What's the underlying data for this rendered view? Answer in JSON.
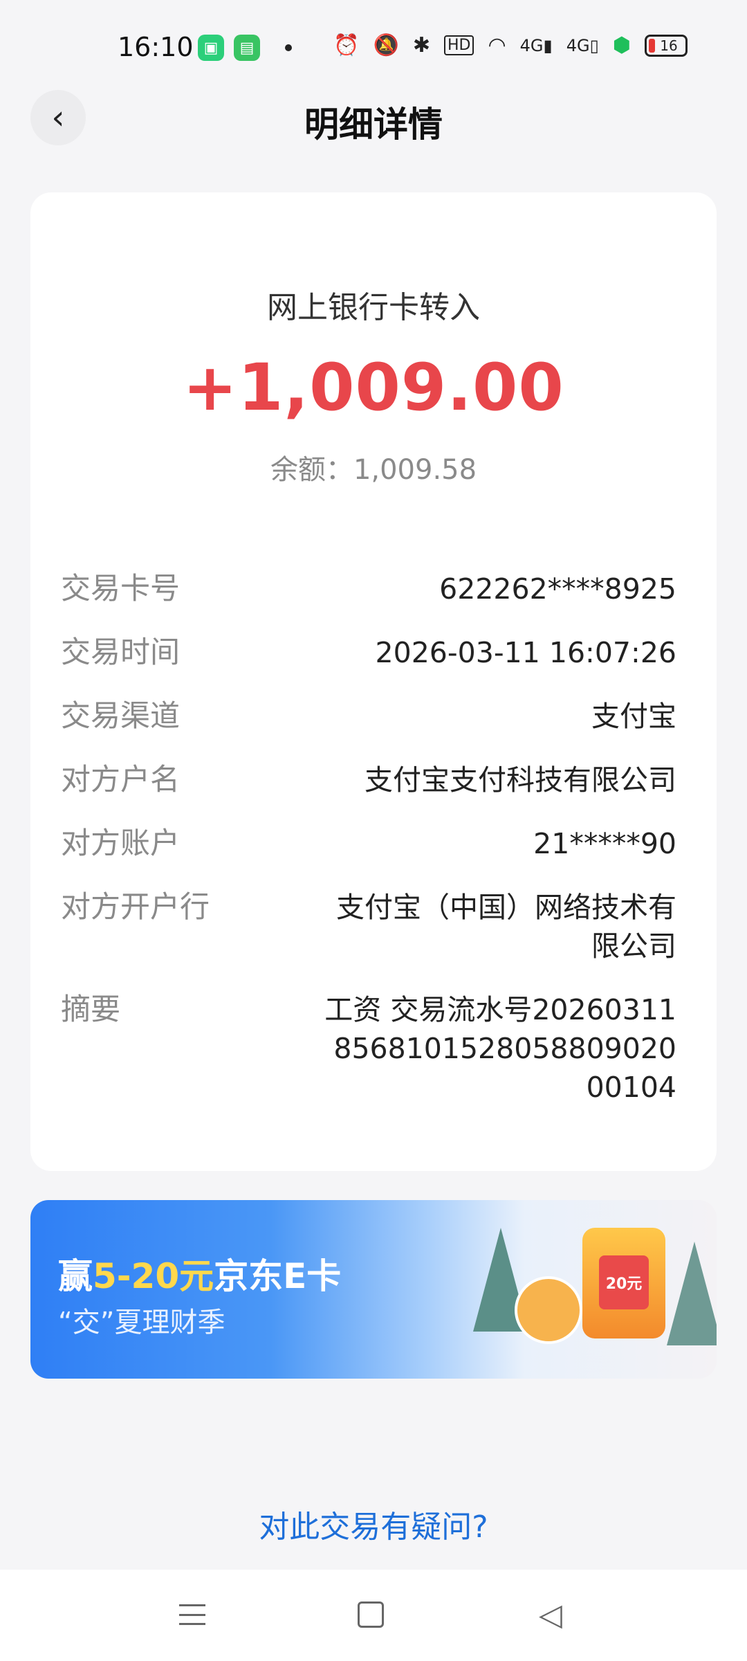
{
  "status_bar": {
    "time": "16:10",
    "battery_level": "16",
    "icons": [
      "alarm-icon",
      "mute-icon",
      "bluetooth-icon",
      "hd-icon",
      "wifi-icon",
      "signal-4g-icon",
      "signal-4g-icon",
      "shield-icon",
      "battery-icon"
    ]
  },
  "header": {
    "title": "明细详情",
    "back_icon": "chevron-left-icon"
  },
  "transaction": {
    "type": "网上银行卡转入",
    "amount": "+1,009.00",
    "balance_label": "余额：",
    "balance_value": "1,009.58",
    "amount_color": "#e8464b"
  },
  "details": [
    {
      "label": "交易卡号",
      "value": "622262****8925"
    },
    {
      "label": "交易时间",
      "value": "2026-03-11 16:07:26"
    },
    {
      "label": "交易渠道",
      "value": "支付宝"
    },
    {
      "label": "对方户名",
      "value": "支付宝支付科技有限公司"
    },
    {
      "label": "对方账户",
      "value": "21*****90"
    },
    {
      "label": "对方开户行",
      "value": "支付宝（中国）网络技术有限公司"
    },
    {
      "label": "摘要",
      "value": "工资 交易流水号20260311856810152805880902000104"
    }
  ],
  "promo": {
    "title_prefix": "赢",
    "title_highlight": "5-20元",
    "title_suffix": "京东E卡",
    "subtitle": "“交”夏理财季",
    "gift_label": "20元"
  },
  "footer": {
    "question_link": "对此交易有疑问?"
  },
  "nav": {
    "menu_icon": "menu-icon",
    "home_icon": "home-square-icon",
    "back_icon": "back-triangle-icon"
  }
}
